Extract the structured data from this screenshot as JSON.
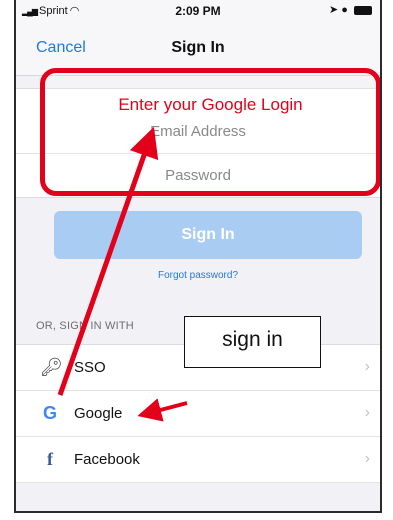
{
  "status_bar": {
    "carrier": "Sprint",
    "time": "2:09 PM"
  },
  "nav": {
    "cancel_label": "Cancel",
    "title": "Sign In"
  },
  "form": {
    "email_placeholder": "Email Address",
    "password_placeholder": "Password",
    "signin_label": "Sign In",
    "forgot_label": "Forgot password?"
  },
  "annotations": {
    "highlight_text": "Enter your Google Login",
    "callout_text": "sign in",
    "accent_color": "#e3001b"
  },
  "alt_signin": {
    "header": "OR, SIGN IN WITH",
    "items": [
      {
        "label": "SSO",
        "icon": "key-icon"
      },
      {
        "label": "Google",
        "icon": "google-icon"
      },
      {
        "label": "Facebook",
        "icon": "facebook-icon"
      }
    ]
  }
}
